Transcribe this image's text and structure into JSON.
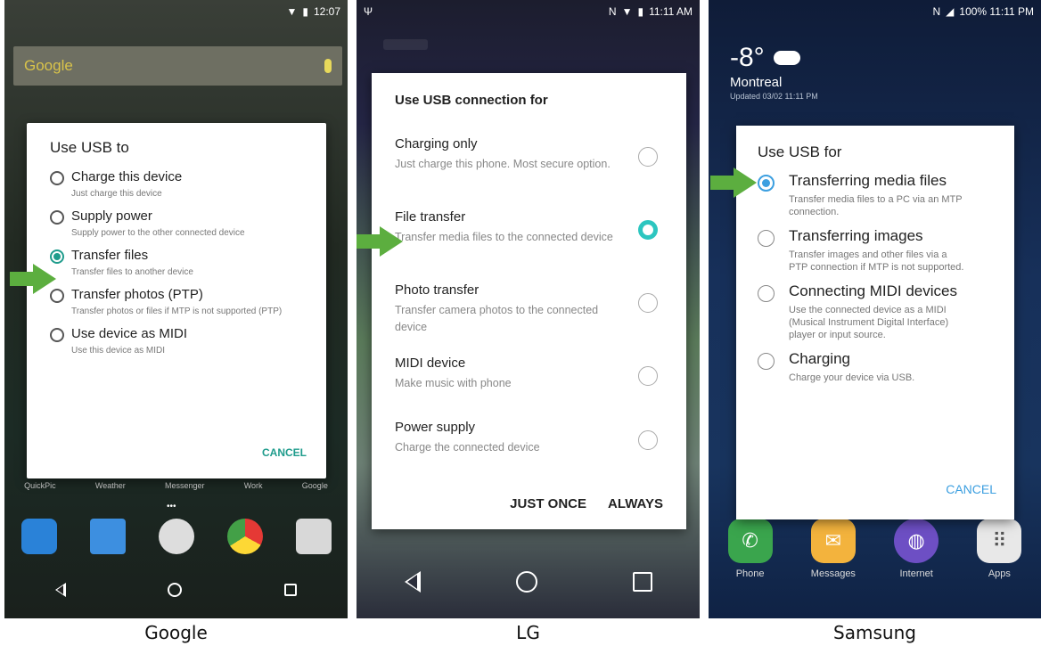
{
  "google": {
    "caption": "Google",
    "status_time": "12:07",
    "search_text": "Google",
    "dialog_title": "Use USB to",
    "options": [
      {
        "label": "Charge this device",
        "desc": "Just charge this device",
        "selected": false
      },
      {
        "label": "Supply power",
        "desc": "Supply power to the other connected device",
        "selected": false
      },
      {
        "label": "Transfer files",
        "desc": "Transfer files to another device",
        "selected": true
      },
      {
        "label": "Transfer photos (PTP)",
        "desc": "Transfer photos or files if MTP is not supported (PTP)",
        "selected": false
      },
      {
        "label": "Use device as MIDI",
        "desc": "Use this device as MIDI",
        "selected": false
      }
    ],
    "cancel": "CANCEL",
    "dock_labels": [
      "QuickPic",
      "Weather",
      "Messenger",
      "Work",
      "Google"
    ],
    "dots": "•••"
  },
  "lg": {
    "caption": "LG",
    "status_time": "11:11 AM",
    "status_left": "Ψ",
    "dialog_title": "Use USB connection for",
    "options": [
      {
        "label": "Charging only",
        "desc": "Just charge this phone. Most secure option.",
        "selected": false
      },
      {
        "label": "File transfer",
        "desc": "Transfer media files to the connected device",
        "selected": true
      },
      {
        "label": "Photo transfer",
        "desc": "Transfer camera photos to the connected device",
        "selected": false
      },
      {
        "label": "MIDI device",
        "desc": "Make music with phone",
        "selected": false
      },
      {
        "label": "Power supply",
        "desc": "Charge the connected device",
        "selected": false
      }
    ],
    "just_once": "JUST ONCE",
    "always": "ALWAYS"
  },
  "samsung": {
    "caption": "Samsung",
    "status_text": "100% 11:11 PM",
    "temp": "-8°",
    "city": "Montreal",
    "updated": "Updated 03/02 11:11 PM",
    "dialog_title": "Use USB for",
    "options": [
      {
        "label": "Transferring media files",
        "desc": "Transfer media files to a PC via an MTP connection.",
        "selected": true
      },
      {
        "label": "Transferring images",
        "desc": "Transfer images and other files via a PTP connection if MTP is not supported.",
        "selected": false
      },
      {
        "label": "Connecting MIDI devices",
        "desc": "Use the connected device as a MIDI (Musical Instrument Digital Interface) player or input source.",
        "selected": false
      },
      {
        "label": "Charging",
        "desc": "Charge your device via USB.",
        "selected": false
      }
    ],
    "cancel": "CANCEL",
    "dock": [
      "Phone",
      "Messages",
      "Internet",
      "Apps"
    ]
  },
  "colors": {
    "google_accent": "#1f9c8c",
    "lg_accent": "#2cc6c0",
    "samsung_accent": "#3c9fe0",
    "arrow": "#5cae3f"
  }
}
